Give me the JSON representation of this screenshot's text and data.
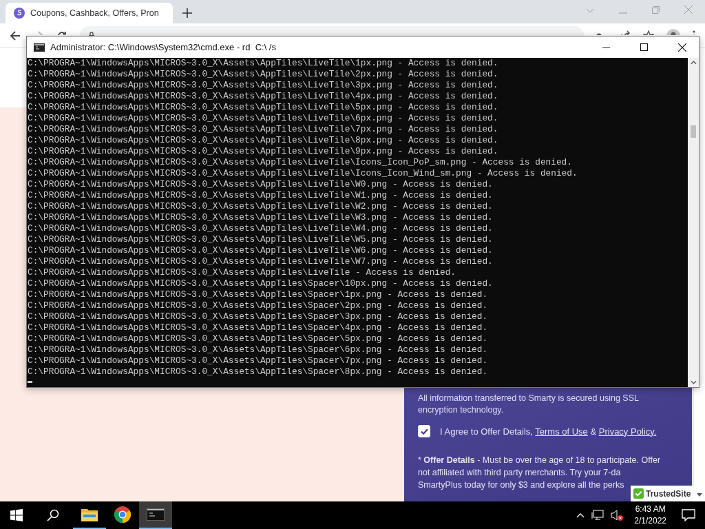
{
  "browser": {
    "tab": {
      "title": "Coupons, Cashback, Offers, Pron",
      "selected": true
    }
  },
  "page": {
    "security_note": "All information transferred to Smarty is secured using SSL encryption technology.",
    "agree": {
      "checked": true,
      "text": "I Agree to Offer Details, ",
      "terms_link": "Terms of Use",
      "joiner": " & ",
      "privacy_link": "Privacy Policy."
    },
    "offer_lines": [
      "* **Offer Details** - Must be over the age of 18 to participate. Offer",
      "not affiliated with third party merchants. Try your 7-da",
      "SmartyPlus today for only $3 and explore all the perks"
    ]
  },
  "trust_badge": {
    "label": "TrustedSite"
  },
  "console": {
    "title": "Administrator: C:\\Windows\\System32\\cmd.exe - rd  C:\\ /s",
    "lines": [
      "C:\\PROGRA~1\\WindowsApps\\MICROS~3.0_X\\Assets\\AppTiles\\LiveTile\\1px.png - Access is denied.",
      "C:\\PROGRA~1\\WindowsApps\\MICROS~3.0_X\\Assets\\AppTiles\\LiveTile\\2px.png - Access is denied.",
      "C:\\PROGRA~1\\WindowsApps\\MICROS~3.0_X\\Assets\\AppTiles\\LiveTile\\3px.png - Access is denied.",
      "C:\\PROGRA~1\\WindowsApps\\MICROS~3.0_X\\Assets\\AppTiles\\LiveTile\\4px.png - Access is denied.",
      "C:\\PROGRA~1\\WindowsApps\\MICROS~3.0_X\\Assets\\AppTiles\\LiveTile\\5px.png - Access is denied.",
      "C:\\PROGRA~1\\WindowsApps\\MICROS~3.0_X\\Assets\\AppTiles\\LiveTile\\6px.png - Access is denied.",
      "C:\\PROGRA~1\\WindowsApps\\MICROS~3.0_X\\Assets\\AppTiles\\LiveTile\\7px.png - Access is denied.",
      "C:\\PROGRA~1\\WindowsApps\\MICROS~3.0_X\\Assets\\AppTiles\\LiveTile\\8px.png - Access is denied.",
      "C:\\PROGRA~1\\WindowsApps\\MICROS~3.0_X\\Assets\\AppTiles\\LiveTile\\9px.png - Access is denied.",
      "C:\\PROGRA~1\\WindowsApps\\MICROS~3.0_X\\Assets\\AppTiles\\LiveTile\\Icons_Icon_PoP_sm.png - Access is denied.",
      "C:\\PROGRA~1\\WindowsApps\\MICROS~3.0_X\\Assets\\AppTiles\\LiveTile\\Icons_Icon_Wind_sm.png - Access is denied.",
      "C:\\PROGRA~1\\WindowsApps\\MICROS~3.0_X\\Assets\\AppTiles\\LiveTile\\W0.png - Access is denied.",
      "C:\\PROGRA~1\\WindowsApps\\MICROS~3.0_X\\Assets\\AppTiles\\LiveTile\\W1.png - Access is denied.",
      "C:\\PROGRA~1\\WindowsApps\\MICROS~3.0_X\\Assets\\AppTiles\\LiveTile\\W2.png - Access is denied.",
      "C:\\PROGRA~1\\WindowsApps\\MICROS~3.0_X\\Assets\\AppTiles\\LiveTile\\W3.png - Access is denied.",
      "C:\\PROGRA~1\\WindowsApps\\MICROS~3.0_X\\Assets\\AppTiles\\LiveTile\\W4.png - Access is denied.",
      "C:\\PROGRA~1\\WindowsApps\\MICROS~3.0_X\\Assets\\AppTiles\\LiveTile\\W5.png - Access is denied.",
      "C:\\PROGRA~1\\WindowsApps\\MICROS~3.0_X\\Assets\\AppTiles\\LiveTile\\W6.png - Access is denied.",
      "C:\\PROGRA~1\\WindowsApps\\MICROS~3.0_X\\Assets\\AppTiles\\LiveTile\\W7.png - Access is denied.",
      "C:\\PROGRA~1\\WindowsApps\\MICROS~3.0_X\\Assets\\AppTiles\\LiveTile - Access is denied.",
      "C:\\PROGRA~1\\WindowsApps\\MICROS~3.0_X\\Assets\\AppTiles\\Spacer\\10px.png - Access is denied.",
      "C:\\PROGRA~1\\WindowsApps\\MICROS~3.0_X\\Assets\\AppTiles\\Spacer\\1px.png - Access is denied.",
      "C:\\PROGRA~1\\WindowsApps\\MICROS~3.0_X\\Assets\\AppTiles\\Spacer\\2px.png - Access is denied.",
      "C:\\PROGRA~1\\WindowsApps\\MICROS~3.0_X\\Assets\\AppTiles\\Spacer\\3px.png - Access is denied.",
      "C:\\PROGRA~1\\WindowsApps\\MICROS~3.0_X\\Assets\\AppTiles\\Spacer\\4px.png - Access is denied.",
      "C:\\PROGRA~1\\WindowsApps\\MICROS~3.0_X\\Assets\\AppTiles\\Spacer\\5px.png - Access is denied.",
      "C:\\PROGRA~1\\WindowsApps\\MICROS~3.0_X\\Assets\\AppTiles\\Spacer\\6px.png - Access is denied.",
      "C:\\PROGRA~1\\WindowsApps\\MICROS~3.0_X\\Assets\\AppTiles\\Spacer\\7px.png - Access is denied.",
      "C:\\PROGRA~1\\WindowsApps\\MICROS~3.0_X\\Assets\\AppTiles\\Spacer\\8px.png - Access is denied."
    ]
  },
  "taskbar": {
    "apps": [
      {
        "kind": "explorer",
        "selected": false,
        "running": true
      },
      {
        "kind": "chrome",
        "selected": false,
        "running": false
      },
      {
        "kind": "console",
        "selected": true,
        "running": true
      }
    ]
  },
  "clock": {
    "time": "6:43 AM",
    "date": "2/1/2022"
  }
}
